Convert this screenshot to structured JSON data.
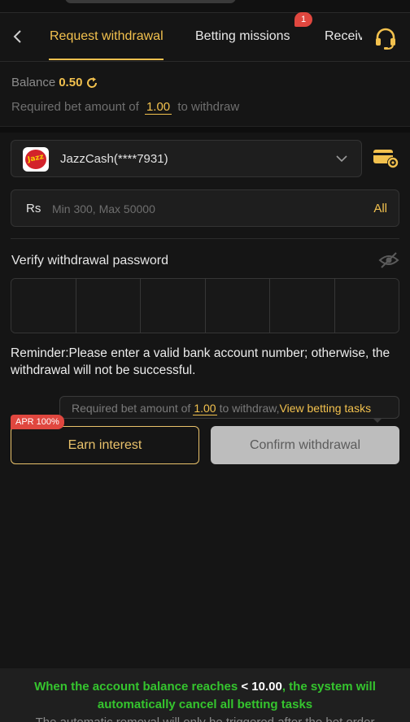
{
  "header": {
    "back_icon": "chevron-left-icon",
    "tabs": [
      {
        "label": "Request withdrawal",
        "active": true
      },
      {
        "label": "Betting missions",
        "badge": "1"
      },
      {
        "label": "Receive"
      }
    ],
    "support_icon": "headset-icon"
  },
  "balance": {
    "label": "Balance",
    "value": "0.50",
    "refresh_icon": "refresh-icon"
  },
  "requirement": {
    "prefix": "Required bet amount of",
    "amount": "1.00",
    "suffix": "to withdraw"
  },
  "account": {
    "name": "JazzCash(****7931)",
    "logo_text": "Jazz",
    "dropdown_icon": "chevron-down-icon",
    "settings_icon": "card-settings-icon"
  },
  "amount_input": {
    "currency": "Rs",
    "placeholder": "Min 300, Max 50000",
    "all_label": "All"
  },
  "password": {
    "label": "Verify withdrawal password",
    "eye_icon": "eye-off-icon",
    "cells": 6
  },
  "reminder": "Reminder:Please enter a valid bank account number; otherwise, the withdrawal will not be successful.",
  "tooltip": {
    "prefix": "Required bet amount of",
    "amount": "1.00",
    "suffix": "to withdraw,",
    "link": "View betting tasks"
  },
  "buttons": {
    "apr_tag": "APR 100%",
    "earn": "Earn interest",
    "confirm": "Confirm withdrawal"
  },
  "footer": {
    "line1_pre": "When the account balance reaches",
    "line1_value": "< 10.00",
    "line1_post": ", the system will",
    "line2": "automatically cancel all betting tasks",
    "line3": "The automatic removal will only be triggered after the bet order"
  },
  "colors": {
    "accent": "#f2c14e",
    "badge": "#e0473f",
    "footer_green": "#35c52e",
    "background": "#151515"
  }
}
